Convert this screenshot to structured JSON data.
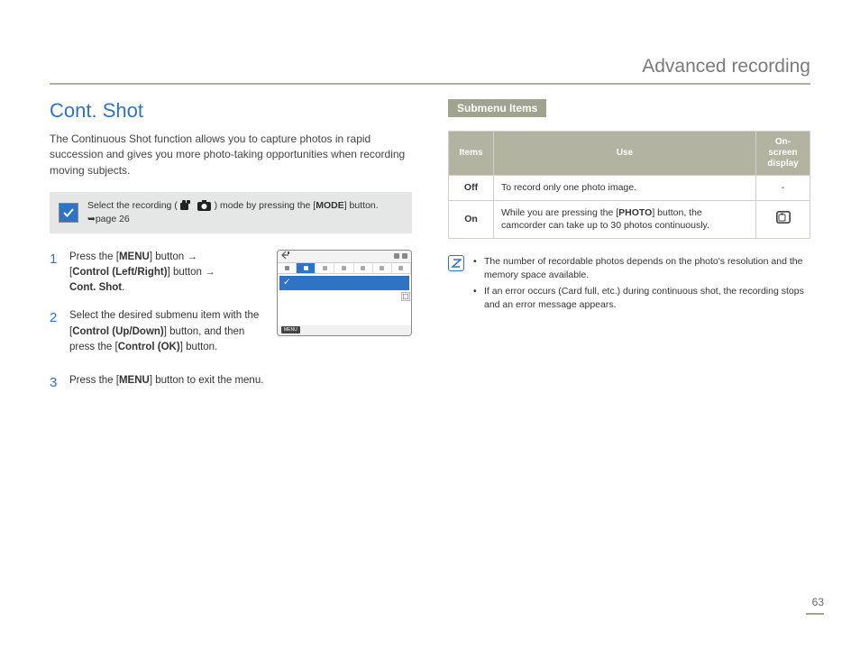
{
  "header": {
    "title": "Advanced recording"
  },
  "left": {
    "section_title": "Cont. Shot",
    "intro": "The Continuous Shot function allows you to capture photos in rapid succession and gives you more photo-taking opportunities when recording moving subjects.",
    "mode_box": {
      "pre": "Select the recording (",
      "post": ") mode by pressing the [",
      "btn": "MODE",
      "tail": "] button. ",
      "pageref": "page 26"
    },
    "step1": {
      "a": "Press the [",
      "b": "MENU",
      "c": "] button ",
      "d": "→",
      "e": " [",
      "f": "Control (Left/Right)",
      "g": "] button ",
      "h": "→",
      "i": " ",
      "j": "Cont. Shot",
      "k": "."
    },
    "step2": {
      "a": "Select the desired submenu item with the [",
      "b": "Control (Up/Down)",
      "c": "] button, and then press the [",
      "d": "Control (OK)",
      "e": "] button."
    },
    "step3": {
      "a": "Press the [",
      "b": "MENU",
      "c": "] button to exit the menu."
    }
  },
  "right": {
    "submenu_title": "Submenu Items",
    "table": {
      "h1": "Items",
      "h2": "Use",
      "h3a": "On-screen",
      "h3b": "display",
      "rows": [
        {
          "item": "Off",
          "use": "To record only one photo image.",
          "disp": "-"
        },
        {
          "item": "On",
          "use_a": "While you are pressing the [",
          "use_b": "PHOTO",
          "use_c": "] button, the camcorder can take up to 30 photos continuously.",
          "disp": "icon"
        }
      ]
    },
    "notes": [
      "The number of recordable photos depends on the photo's resolution and the memory space available.",
      "If an error occurs (Card full, etc.) during continuous shot, the recording stops and an error message appears."
    ]
  },
  "page_number": "63"
}
